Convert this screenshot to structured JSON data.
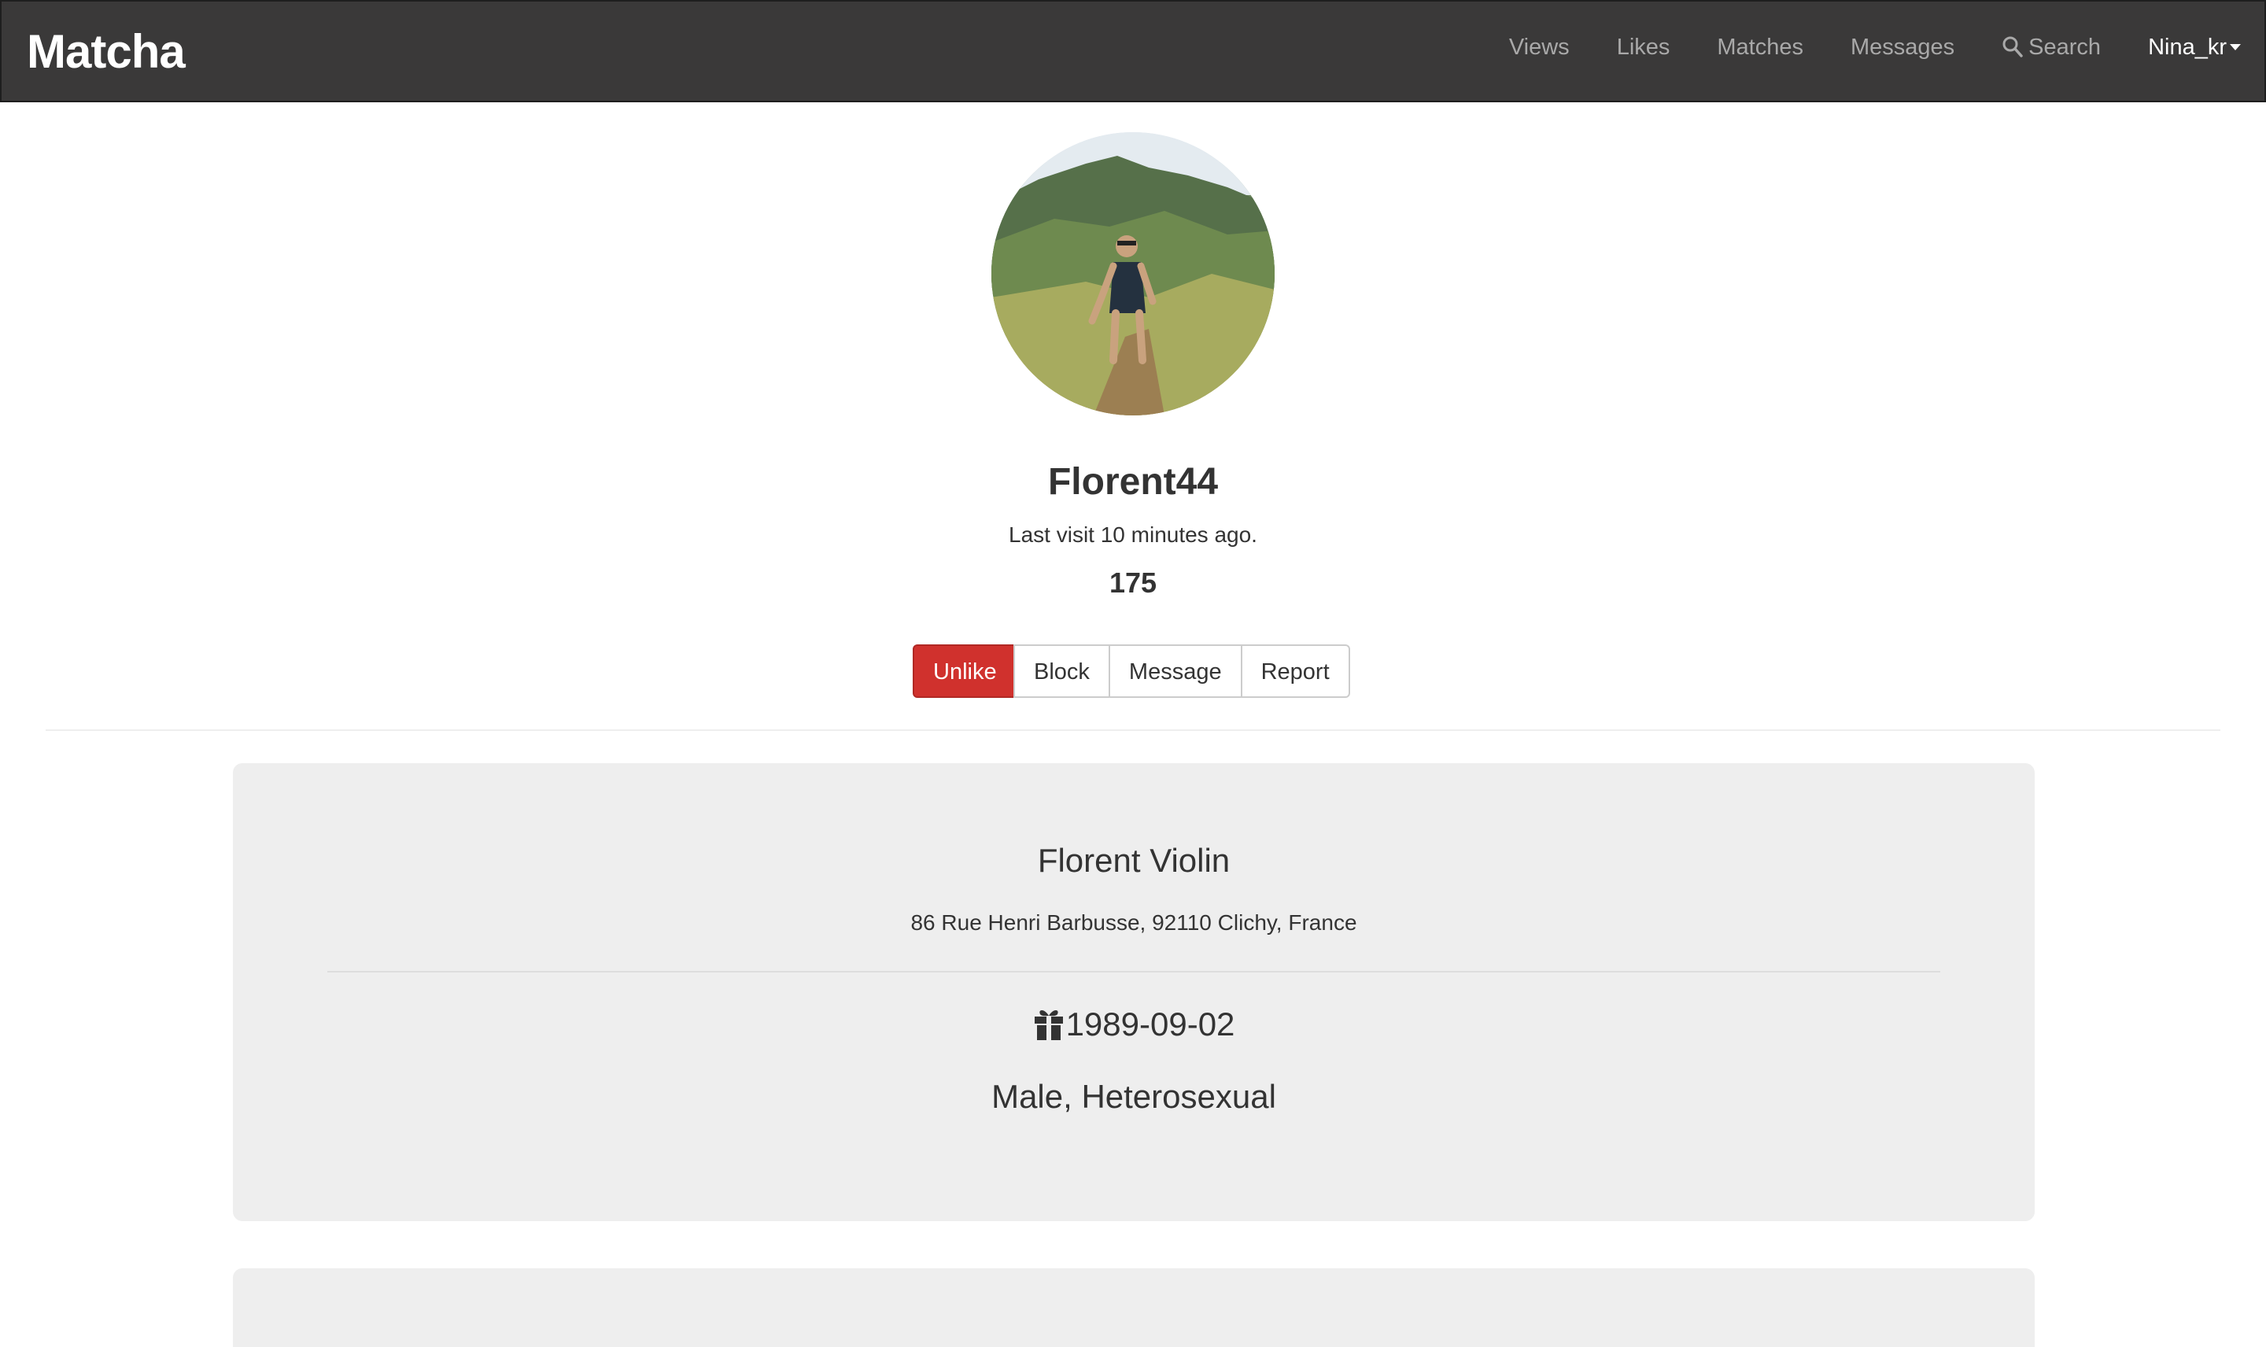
{
  "navbar": {
    "brand": "Matcha",
    "links": {
      "views": "Views",
      "likes": "Likes",
      "matches": "Matches",
      "messages": "Messages",
      "search": "Search"
    },
    "user": "Nina_kr"
  },
  "profile": {
    "username": "Florent44",
    "last_visit": "Last visit 10 minutes ago.",
    "score": "175"
  },
  "actions": {
    "unlike": "Unlike",
    "block": "Block",
    "message": "Message",
    "report": "Report"
  },
  "details": {
    "full_name": "Florent Violin",
    "address": "86 Rue Henri Barbusse, 92110 Clichy, France",
    "birthdate": "1989-09-02",
    "gender_orientation": "Male, Heterosexual"
  },
  "colors": {
    "navbar_bg": "#3a3939",
    "unlike_button": "#d0312d",
    "card_bg": "#eeeeee"
  },
  "icons": [
    "search-icon",
    "caret-down-icon",
    "gift-icon"
  ]
}
